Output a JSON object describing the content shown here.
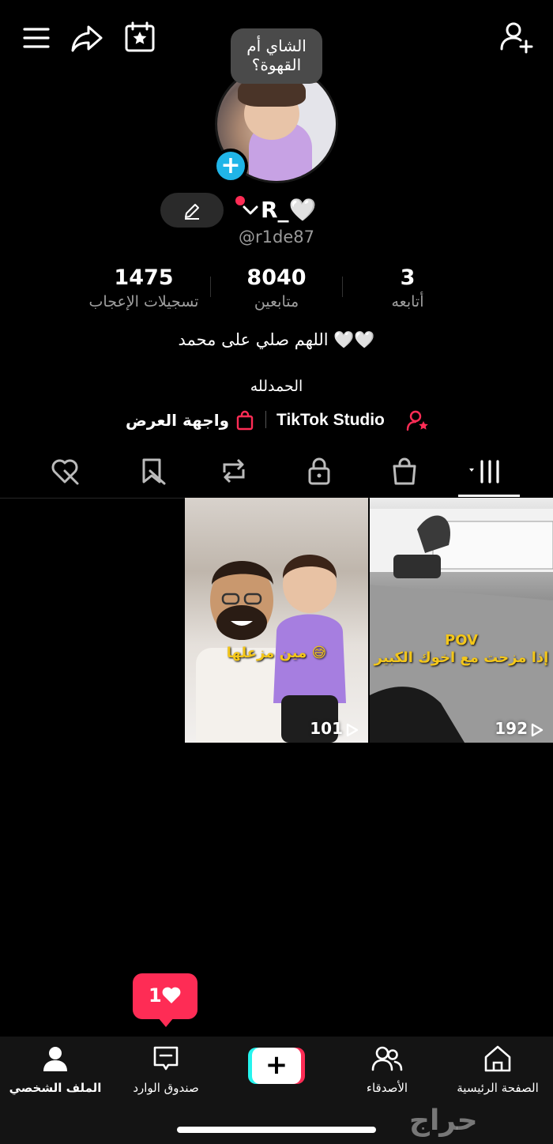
{
  "header": {
    "menu_icon": "hamburger-menu-icon",
    "share_icon": "share-arrow-icon",
    "calendar_icon": "calendar-star-icon",
    "add_friend_icon": "add-user-icon"
  },
  "profile": {
    "status_bubble": "الشاي أم القهوة؟",
    "display_name": "R_🤍",
    "username": "@r1de87",
    "stats": {
      "following": {
        "value": "3",
        "label": "أتابعه"
      },
      "followers": {
        "value": "8040",
        "label": "متابعين"
      },
      "likes": {
        "value": "1475",
        "label": "تسجيلات الإعجاب"
      }
    },
    "bio_line1": "اللهم صلي على محمد 🤍🤍",
    "bio_line2": "الحمدلله",
    "links": {
      "studio": "TikTok Studio",
      "storefront": "واجهة العرض"
    }
  },
  "tabs": [
    {
      "id": "videos",
      "icon": "grid-icon"
    },
    {
      "id": "shop",
      "icon": "shopping-bag-icon"
    },
    {
      "id": "private",
      "icon": "lock-icon"
    },
    {
      "id": "reposts",
      "icon": "repost-icon"
    },
    {
      "id": "favorites",
      "icon": "bookmark-icon"
    },
    {
      "id": "liked",
      "icon": "heart-hidden-icon"
    }
  ],
  "videos": [
    {
      "views": "192",
      "caption": "POV\nإذا مزحت مع اخوك الكبير"
    },
    {
      "views": "101",
      "caption": "مين مزعلها 😅"
    }
  ],
  "notification": {
    "count": "1"
  },
  "bottom_nav": {
    "home": "الصفحة الرئيسية",
    "friends": "الأصدقاء",
    "inbox": "صندوق الوارد",
    "profile": "الملف الشخصي"
  },
  "watermark": "حراج",
  "colors": {
    "accent": "#fe2c55",
    "cyan": "#25f4ee",
    "plus_badge": "#20b5e8",
    "background": "#000000"
  }
}
